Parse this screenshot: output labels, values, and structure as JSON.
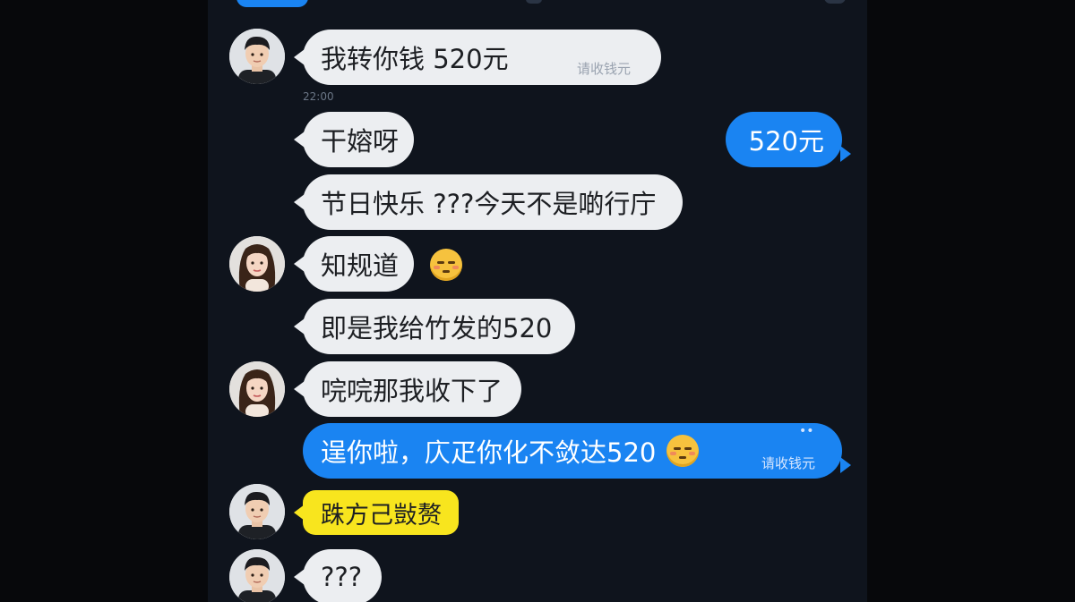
{
  "messages": [
    {
      "text": "我转你钱  520元",
      "sub": "请收钱元",
      "side": "left",
      "style": "white",
      "avatar": "male"
    },
    {
      "timestamp": "22:00"
    },
    {
      "text": "干嫆呀",
      "side": "left",
      "style": "white"
    },
    {
      "text": "520元",
      "side": "right",
      "style": "blue"
    },
    {
      "text": "节日快乐  ???今天不是啲行庁",
      "side": "left",
      "style": "white"
    },
    {
      "text": "知规道",
      "side": "left",
      "style": "white",
      "avatar": "female",
      "emoji": "smirk-emoji"
    },
    {
      "text": "即是我给竹发的520",
      "side": "left",
      "style": "white"
    },
    {
      "text": "唍唍那我收下了",
      "side": "left",
      "style": "white",
      "avatar": "female"
    },
    {
      "text": "逞你啦，庂疋你化不敛达520",
      "sub": "请收钱元",
      "side": "right",
      "style": "blue",
      "emoji": "smirk-emoji"
    },
    {
      "text": "跦方己敱赘",
      "side": "left",
      "style": "yellow",
      "avatar": "male"
    },
    {
      "text": "???",
      "side": "left",
      "style": "white",
      "avatar": "male"
    }
  ],
  "colors": {
    "background": "#0f141d",
    "white_bubble": "#eceef1",
    "blue_bubble": "#1a84f2",
    "yellow_bubble": "#f8e51e"
  }
}
